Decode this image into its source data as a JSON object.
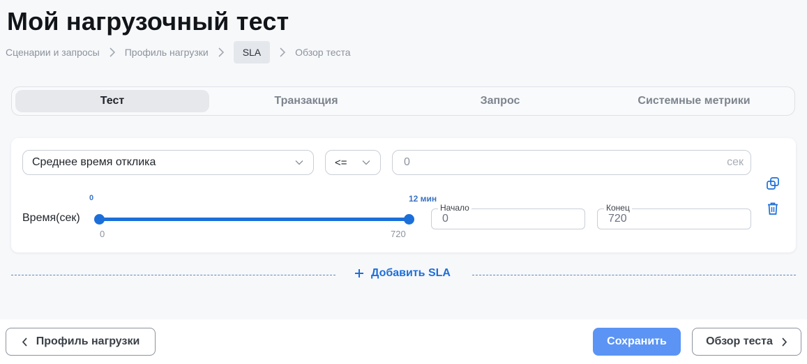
{
  "page": {
    "title": "Мой нагрузочный тест"
  },
  "breadcrumb": {
    "items": [
      {
        "label": "Сценарии и запросы",
        "active": false
      },
      {
        "label": "Профиль нагрузки",
        "active": false
      },
      {
        "label": "SLA",
        "active": true
      },
      {
        "label": "Обзор теста",
        "active": false
      }
    ]
  },
  "tabs": [
    {
      "label": "Тест",
      "active": true
    },
    {
      "label": "Транзакция",
      "active": false
    },
    {
      "label": "Запрос",
      "active": false
    },
    {
      "label": "Системные метрики",
      "active": false
    }
  ],
  "sla": {
    "metric": "Среднее время отклика",
    "operator": "<=",
    "value": "0",
    "unit": "сек",
    "time_label": "Время(сек)",
    "slider": {
      "top_min_label": "0",
      "top_max_label": "12 мин",
      "bottom_min_label": "0",
      "bottom_max_label": "720",
      "range_start_fraction": 0,
      "range_end_fraction": 1
    },
    "start": {
      "legend": "Начало",
      "value": "0"
    },
    "end": {
      "legend": "Конец",
      "value": "720"
    },
    "icons": {
      "copy": "copy-icon",
      "delete": "trash-icon"
    }
  },
  "add_sla": {
    "label": "Добавить SLA",
    "icon": "plus-icon"
  },
  "footer": {
    "back_label": "Профиль нагрузки",
    "save_label": "Сохранить",
    "next_label": "Обзор теста"
  },
  "colors": {
    "accent": "#1c6fd9",
    "save_button": "#5b94f4",
    "background": "#f7f8fa"
  }
}
